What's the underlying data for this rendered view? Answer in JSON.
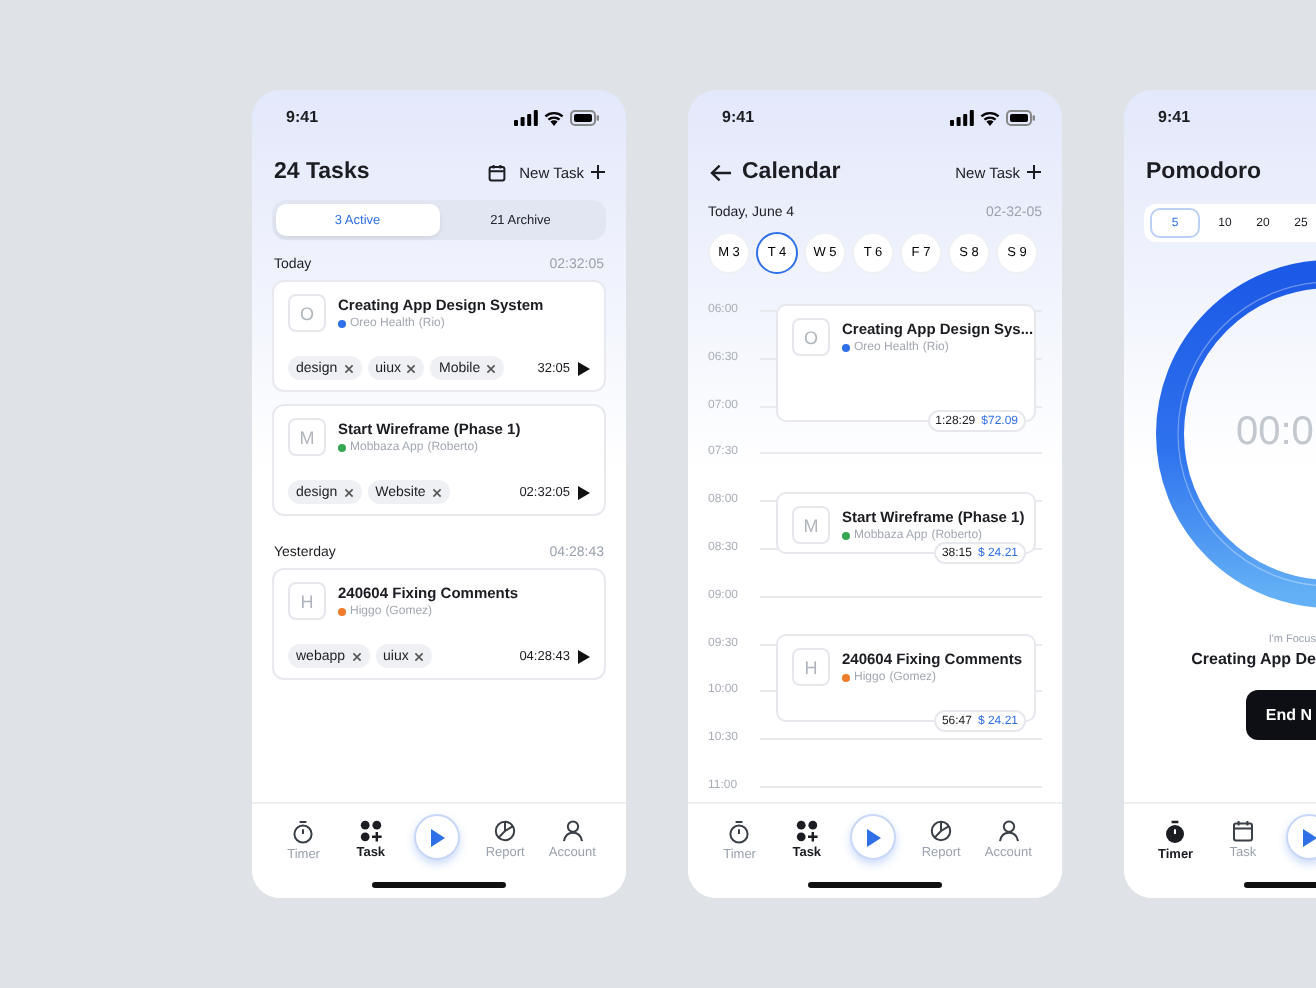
{
  "phones": [
    {
      "kind": "tasks",
      "status_time": "9:41",
      "title": "24 Tasks",
      "new_task": "New Task",
      "segments": [
        {
          "label": "3 Active",
          "selected": true
        },
        {
          "label": "21 Archive",
          "selected": false
        }
      ],
      "groups": [
        {
          "label": "Today",
          "total": "02:32:05",
          "tasks": [
            {
              "initial": "O",
              "title": "Creating App Design System",
              "client": "Oreo Health",
              "person": "(Rio)",
              "color": "#2f6fe8",
              "tags": [
                "design",
                "uiux",
                "Mobile"
              ],
              "time": "32:05"
            },
            {
              "initial": "M",
              "title": "Start Wireframe (Phase 1)",
              "client": "Mobbaza App",
              "person": "(Roberto)",
              "color": "#34a853",
              "tags": [
                "design",
                "Website"
              ],
              "time": "02:32:05"
            }
          ]
        },
        {
          "label": "Yesterday",
          "total": "04:28:43",
          "tasks": [
            {
              "initial": "H",
              "title": "240604 Fixing Comments",
              "client": "Higgo",
              "person": "(Gomez)",
              "color": "#f07b2a",
              "tags": [
                "webapp",
                "uiux"
              ],
              "time": "04:28:43"
            }
          ]
        }
      ],
      "tabbar": [
        {
          "label": "Timer",
          "selected": false
        },
        {
          "label": "Task",
          "selected": true
        },
        {
          "label": "Report",
          "selected": false
        },
        {
          "label": "Account",
          "selected": false
        }
      ]
    },
    {
      "kind": "calendar",
      "status_time": "9:41",
      "title": "Calendar",
      "new_task": "New Task",
      "date": "Today, June 4",
      "clock": "02-32-05",
      "days": [
        {
          "letter": "M",
          "number": "3",
          "selected": false
        },
        {
          "letter": "T",
          "number": "4",
          "selected": true
        },
        {
          "letter": "W",
          "number": "5",
          "selected": false
        },
        {
          "letter": "T",
          "number": "6",
          "selected": false
        },
        {
          "letter": "F",
          "number": "7",
          "selected": false
        },
        {
          "letter": "S",
          "number": "8",
          "selected": false
        },
        {
          "letter": "S",
          "number": "9",
          "selected": false
        }
      ],
      "hours": [
        "06:00",
        "06:30",
        "07:00",
        "07:30",
        "08:00",
        "08:30",
        "09:00",
        "09:30",
        "10:00",
        "10:30",
        "11:00"
      ],
      "events": [
        {
          "initial": "O",
          "title": "Creating App Design Sys...",
          "client": "Oreo Health",
          "person": "(Rio)",
          "color": "#2f6fe8",
          "duration": "1:28:29",
          "amount": "$72.09"
        },
        {
          "initial": "M",
          "title": "Start Wireframe (Phase 1)",
          "client": "Mobbaza App",
          "person": "(Roberto)",
          "color": "#34a853",
          "duration": "38:15",
          "amount": "$ 24.21"
        },
        {
          "initial": "H",
          "title": "240604 Fixing Comments",
          "client": "Higgo",
          "person": "(Gomez)",
          "color": "#f07b2a",
          "duration": "56:47",
          "amount": "$ 24.21"
        }
      ],
      "tabbar": [
        {
          "label": "Timer",
          "selected": false
        },
        {
          "label": "Task",
          "selected": true
        },
        {
          "label": "Report",
          "selected": false
        },
        {
          "label": "Account",
          "selected": false
        }
      ]
    },
    {
      "kind": "pomodoro",
      "status_time": "9:41",
      "title": "Pomodoro",
      "durations": [
        {
          "label": "5",
          "selected": true
        },
        {
          "label": "10",
          "selected": false
        },
        {
          "label": "20",
          "selected": false
        },
        {
          "label": "25",
          "selected": false
        }
      ],
      "timer": "00:0",
      "focus_caption": "I'm Focus",
      "focus_task": "Creating App De",
      "end_button": "End N",
      "tabbar": [
        {
          "label": "Timer",
          "selected": true
        },
        {
          "label": "Task",
          "selected": false
        }
      ]
    }
  ]
}
